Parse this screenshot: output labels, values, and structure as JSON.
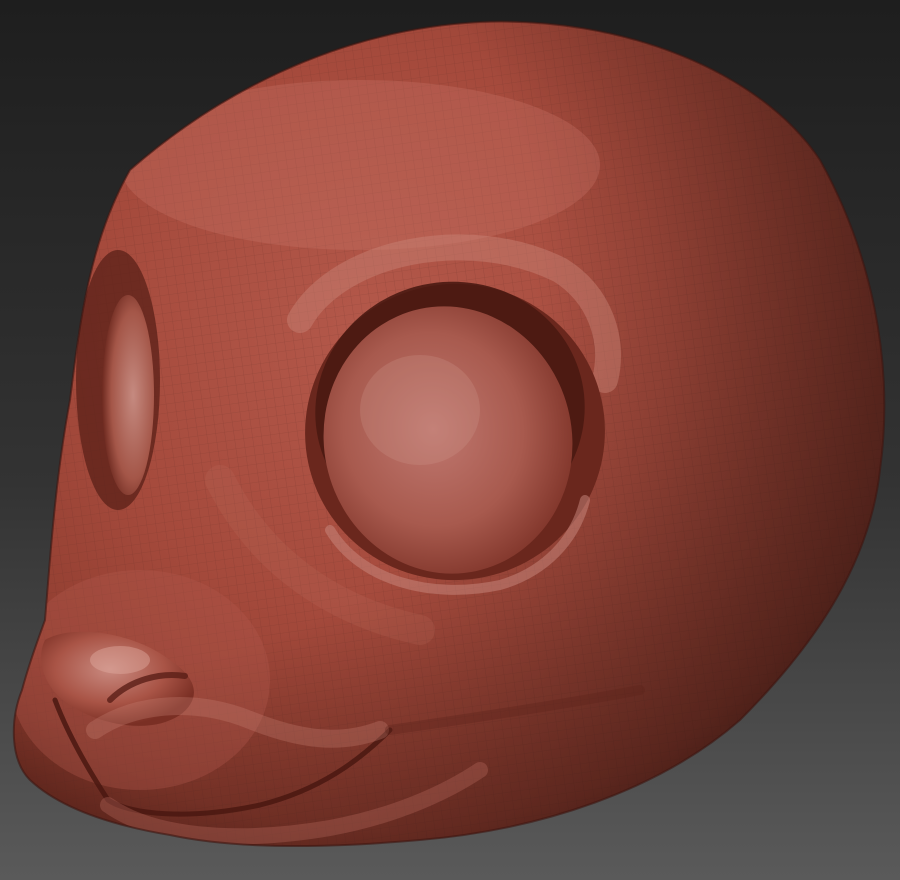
{
  "scene": {
    "subject": "sculpted-animal-head",
    "material": "red-wax",
    "colors": {
      "background_top": "#1e1e1e",
      "background_bottom": "#5a5a5a",
      "clay_highlight": "#c58a80",
      "clay_light": "#b4594b",
      "clay_mid": "#9c4436",
      "clay_dark": "#6e2a20",
      "clay_shadow": "#3e1610",
      "mesh_line": "#5a2a22"
    },
    "visible_features": [
      "head",
      "brow",
      "eye-socket",
      "far-eye-socket",
      "cheek",
      "snout",
      "nose",
      "mouth-line",
      "lower-lip"
    ]
  }
}
